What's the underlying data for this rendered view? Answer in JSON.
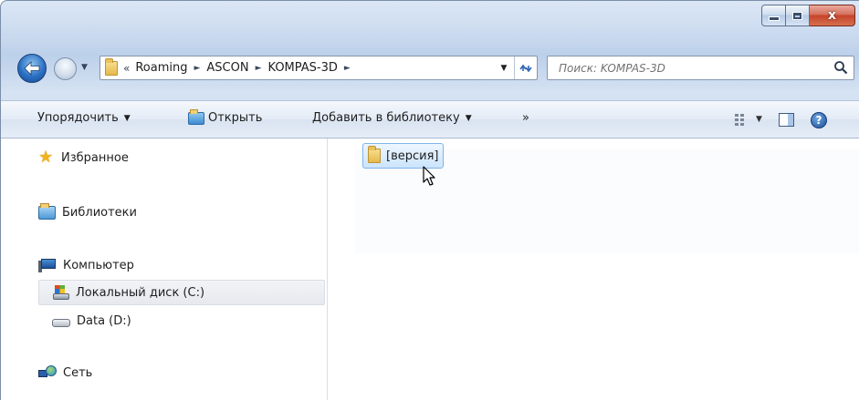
{
  "window": {
    "caption_buttons": {
      "minimize_icon": "minimize-icon",
      "maximize_icon": "maximize-icon",
      "close_glyph": "x"
    }
  },
  "address_bar": {
    "overflow": "«",
    "breadcrumbs": [
      "Roaming",
      "ASCON",
      "KOMPAS-3D"
    ],
    "separator": "►"
  },
  "search": {
    "placeholder": "Поиск: KOMPAS-3D",
    "value": ""
  },
  "command_bar": {
    "organize": "Упорядочить",
    "open": "Открыть",
    "add_to_library": "Добавить в библиотеку",
    "more": "»"
  },
  "navigation_pane": {
    "favorites": "Избранное",
    "libraries": "Библиотеки",
    "computer": "Компьютер",
    "drive_c": "Локальный диск (C:)",
    "drive_d": "Data (D:)",
    "network": "Сеть"
  },
  "content": {
    "items": [
      {
        "name": "[версия]",
        "type": "folder",
        "selected": true
      }
    ]
  },
  "colors": {
    "selection_fill": "#cbe4fc",
    "selection_border": "#7fb4e8",
    "close_button": "#c7432b",
    "frame_blue": "#c9d9ee"
  }
}
